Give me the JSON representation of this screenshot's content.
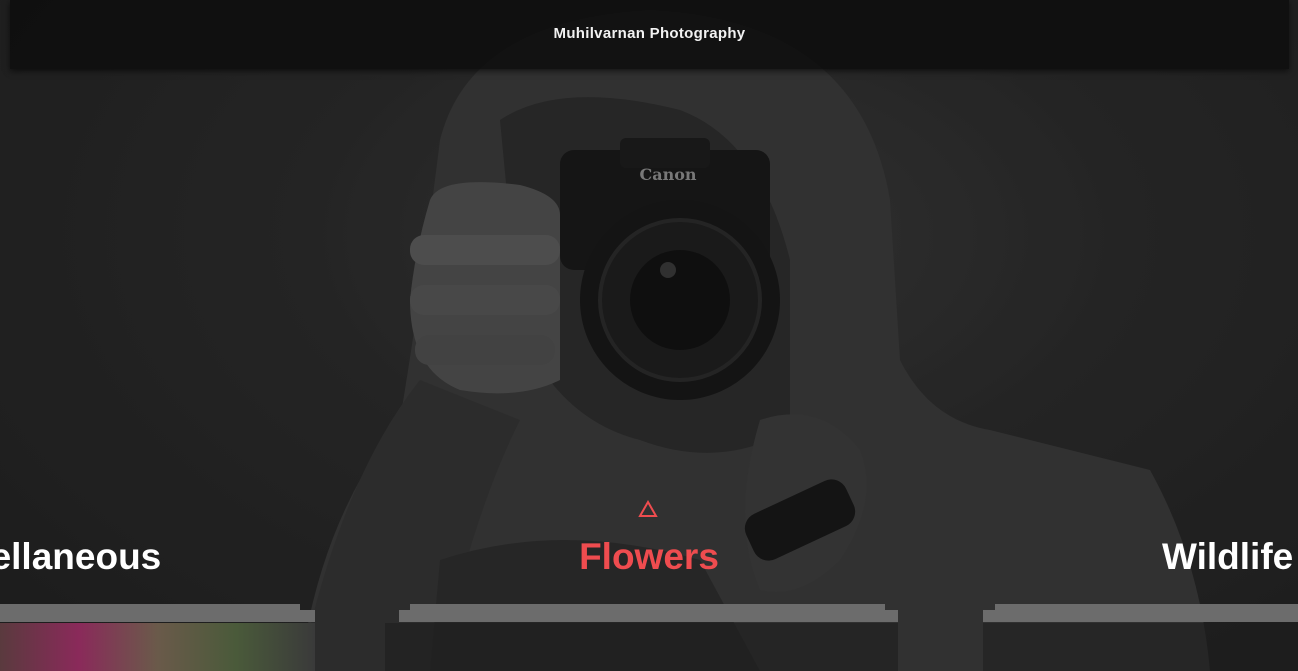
{
  "header": {
    "brand": "Muhilvarnan Photography"
  },
  "categories": {
    "left": "cellaneous",
    "center": "Flowers",
    "right": "Wildlife"
  },
  "colors": {
    "accent": "#ef4c4f",
    "header_bg": "#0e0e0e",
    "text": "#ffffff",
    "bar": "#6c6c6c"
  },
  "icons": {
    "active_indicator": "triangle-up-outline"
  }
}
